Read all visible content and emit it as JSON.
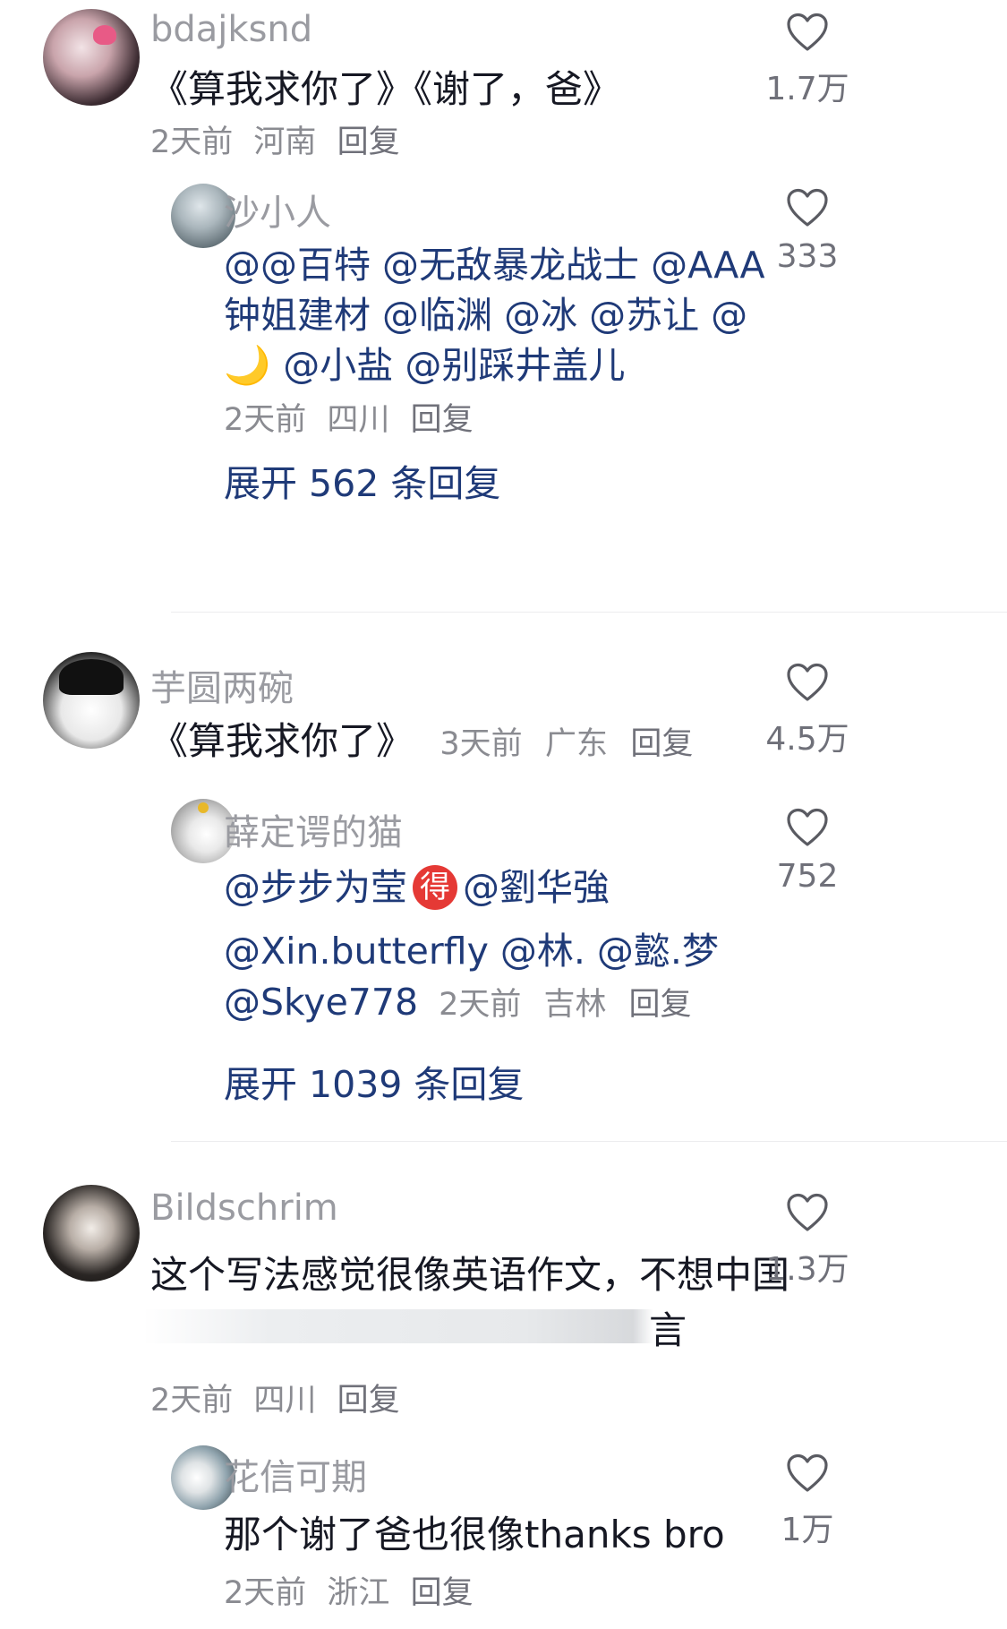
{
  "comments": [
    {
      "username": "bdajksnd",
      "text": "《算我求你了》《谢了，爸》",
      "meta": {
        "time": "2天前",
        "location": "河南",
        "reply": "回复"
      },
      "likes": "1.7万",
      "replies": [
        {
          "username": "沙小人",
          "lines": [
            "@@百特 @无敌暴龙战士 @AAA",
            "钟姐建材 @临渊 @冰 @苏让 @",
            "@小盐 @别踩井盖儿"
          ],
          "moon": "🌙",
          "meta": {
            "time": "2天前",
            "location": "四川",
            "reply": "回复"
          },
          "likes": "333"
        }
      ],
      "expand": "展开 562 条回复"
    },
    {
      "username": "芋圆两碗",
      "text": "《算我求你了》",
      "meta": {
        "time": "3天前",
        "location": "广东",
        "reply": "回复"
      },
      "likes": "4.5万",
      "replies": [
        {
          "username": "薛定谔的猫",
          "line1a": "@步步为莹",
          "badge": "得",
          "line1b": "@劉华強",
          "line2": "@Xin.butterfly @林. @懿.梦",
          "line3": "@Skye778",
          "meta": {
            "time": "2天前",
            "location": "吉林",
            "reply": "回复"
          },
          "likes": "752"
        }
      ],
      "expand": "展开 1039 条回复"
    },
    {
      "username": "Bildschrim",
      "text": "这个写法感觉很像英语作文，不想中国",
      "text_tail": "言",
      "meta": {
        "time": "2天前",
        "location": "四川",
        "reply": "回复"
      },
      "likes": "1.3万",
      "replies": [
        {
          "username": "花信可期",
          "text": "那个谢了爸也很像thanks bro",
          "meta": {
            "time": "2天前",
            "location": "浙江",
            "reply": "回复"
          },
          "likes": "1万"
        }
      ]
    }
  ],
  "icons": {
    "like": "heart-outline-icon"
  },
  "colors": {
    "mention": "#1f3a78",
    "username": "#9a9ba1",
    "meta": "#8a8b91",
    "badge": "#e53935"
  }
}
